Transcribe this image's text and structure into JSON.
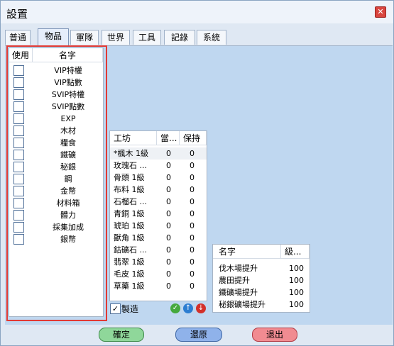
{
  "window": {
    "title": "設置",
    "close_icon": "close-icon"
  },
  "tabs": [
    {
      "label": "普通",
      "active": false
    },
    {
      "label": "物品",
      "active": true
    },
    {
      "label": "軍隊",
      "active": false
    },
    {
      "label": "世界",
      "active": false
    },
    {
      "label": "工具",
      "active": false
    },
    {
      "label": "記錄",
      "active": false
    },
    {
      "label": "系統",
      "active": false
    }
  ],
  "items_list": {
    "headers": {
      "use": "使用",
      "name": "名字"
    },
    "rows": [
      {
        "name": "VIP特權"
      },
      {
        "name": "VIP點數"
      },
      {
        "name": "SVIP特權"
      },
      {
        "name": "SVIP點數"
      },
      {
        "name": "EXP"
      },
      {
        "name": "木材"
      },
      {
        "name": "糧食"
      },
      {
        "name": "鐵礦"
      },
      {
        "name": "秘銀"
      },
      {
        "name": "鋼"
      },
      {
        "name": "金幣"
      },
      {
        "name": "材料箱"
      },
      {
        "name": "體力"
      },
      {
        "name": "採集加成"
      },
      {
        "name": "銀幣"
      }
    ]
  },
  "workshop_list": {
    "headers": {
      "name": "工坊",
      "current": "當...",
      "keep": "保持"
    },
    "rows": [
      {
        "name": "*楓木 1級",
        "current": "0",
        "keep": "0"
      },
      {
        "name": "玫瑰石 ...",
        "current": "0",
        "keep": "0"
      },
      {
        "name": "骨頭 1級",
        "current": "0",
        "keep": "0"
      },
      {
        "name": "布料 1級",
        "current": "0",
        "keep": "0"
      },
      {
        "name": "石榴石 ...",
        "current": "0",
        "keep": "0"
      },
      {
        "name": "青銅 1級",
        "current": "0",
        "keep": "0"
      },
      {
        "name": "琥珀 1級",
        "current": "0",
        "keep": "0"
      },
      {
        "name": "獸角 1級",
        "current": "0",
        "keep": "0"
      },
      {
        "name": "鈷礦石 ...",
        "current": "0",
        "keep": "0"
      },
      {
        "name": "翡翠 1級",
        "current": "0",
        "keep": "0"
      },
      {
        "name": "毛皮 1級",
        "current": "0",
        "keep": "0"
      },
      {
        "name": "草藥 1級",
        "current": "0",
        "keep": "0"
      }
    ],
    "craft_label": "製造",
    "craft_checked": true
  },
  "upgrade_list": {
    "headers": {
      "name": "名字",
      "level": "級..."
    },
    "rows": [
      {
        "name": "伐木場提升",
        "level": "100"
      },
      {
        "name": "農田提升",
        "level": "100"
      },
      {
        "name": "鐵礦場提升",
        "level": "100"
      },
      {
        "name": "秘銀礦場提升",
        "level": "100"
      }
    ]
  },
  "buttons": {
    "confirm": "確定",
    "restore": "還原",
    "exit": "退出"
  },
  "icons": {
    "check": "check-icon",
    "up": "up-arrow-icon",
    "down": "down-arrow-icon"
  },
  "colors": {
    "highlight": "#e23a34",
    "confirm_bg": "#8fd79a",
    "restore_bg": "#8fb2ea",
    "exit_bg": "#f18b91"
  }
}
